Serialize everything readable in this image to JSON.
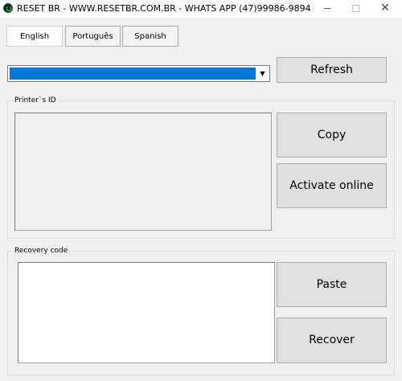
{
  "window": {
    "title": "RESET BR - WWW.RESETBR.COM.BR - WHATS APP (47)99986-9894",
    "icon": "power-icon",
    "controls": {
      "minimize": "",
      "maximize": "",
      "close": "✕"
    }
  },
  "tabs": [
    {
      "label": "English",
      "active": true
    },
    {
      "label": "Português",
      "active": false
    },
    {
      "label": "Spanish",
      "active": false
    }
  ],
  "printer_select": {
    "selected_value": "",
    "highlight_color": "#0078d7"
  },
  "buttons": {
    "refresh": "Refresh",
    "copy": "Copy",
    "activate_online": "Activate online",
    "paste": "Paste",
    "recover": "Recover"
  },
  "printer_group": {
    "legend": "Printer`s ID",
    "value": ""
  },
  "recovery_group": {
    "legend": "Recovery code",
    "value": ""
  }
}
